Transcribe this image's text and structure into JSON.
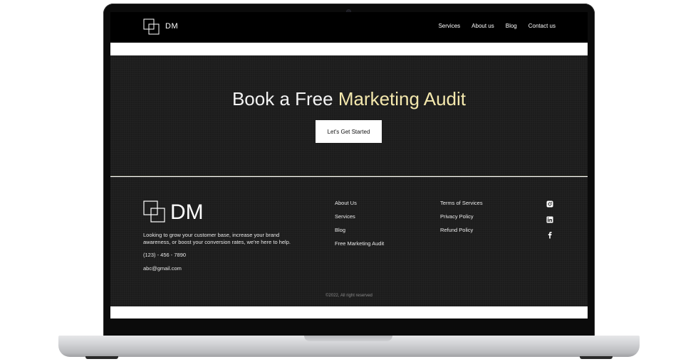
{
  "nav": {
    "brand": "DM",
    "links": [
      "Services",
      "About us",
      "Blog",
      "Contact us"
    ]
  },
  "hero": {
    "title_part1": "Book a Free ",
    "title_accent": "Marketing Audit",
    "cta_label": "Let's Get Started"
  },
  "footer": {
    "brand": "DM",
    "description": "Looking to grow your customer base, increase your brand awareness, or boost your conversion rates, we're here to help.",
    "phone": "(123) - 456 - 7890",
    "email": "abc@gmail.com",
    "col1": [
      "About Us",
      "Services",
      "Blog",
      "Free Marketing Audit"
    ],
    "col2": [
      "Terms of Services",
      "Privacy Policy",
      "Refund Policy"
    ],
    "social_icons": [
      "instagram-icon",
      "linkedin-icon",
      "facebook-icon"
    ],
    "copyright": "©2022, All right reserved"
  },
  "colors": {
    "background_dark": "#1c1c1c",
    "accent": "#f4e8ad",
    "nav_bg": "#000000"
  }
}
